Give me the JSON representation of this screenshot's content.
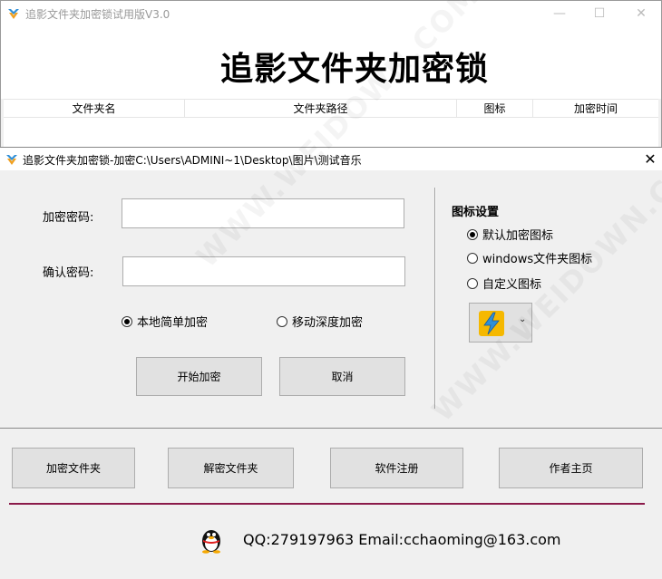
{
  "main_window": {
    "title": "追影文件夹加密锁试用版V3.0",
    "heading": "追影文件夹加密锁",
    "controls": {
      "minimize": "—",
      "maximize": "☐",
      "close": "✕"
    },
    "columns": [
      "文件夹名",
      "文件夹路径",
      "图标",
      "加密时间"
    ]
  },
  "dialog": {
    "title": "追影文件夹加密锁-加密C:\\Users\\ADMINI~1\\Desktop\\图片\\测试音乐",
    "close": "✕",
    "password_label": "加密密码:",
    "confirm_label": "确认密码:",
    "password_value": "",
    "confirm_value": "",
    "mode_local": "本地简单加密",
    "mode_mobile": "移动深度加密",
    "start_button": "开始加密",
    "cancel_button": "取消",
    "icon_settings": {
      "title": "图标设置",
      "default": "默认加密图标",
      "windows": "windows文件夹图标",
      "custom": "自定义图标",
      "picker_arrow": "⌄"
    }
  },
  "bottom": {
    "buttons": [
      "加密文件夹",
      "解密文件夹",
      "软件注册",
      "作者主页"
    ],
    "contact": "QQ:279197963 Email:cchaoming@163.com"
  },
  "colors": {
    "accent_line": "#8b1a4a"
  },
  "watermark": "WWW.WEIDOWN.COM"
}
